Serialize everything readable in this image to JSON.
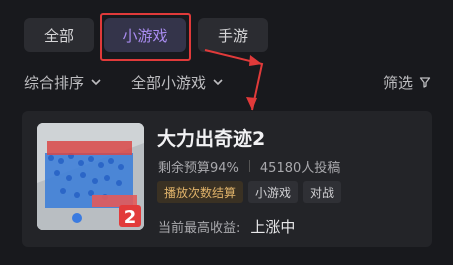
{
  "tabs": [
    {
      "label": "全部"
    },
    {
      "label": "小游戏"
    },
    {
      "label": "手游"
    }
  ],
  "filters": {
    "sort_label": "综合排序",
    "category_label": "全部小游戏",
    "screen_label": "筛选"
  },
  "card": {
    "title": "大力出奇迹2",
    "budget": "剩余预算94%",
    "submissions": "45180人投稿",
    "tags": [
      "播放次数结算",
      "小游戏",
      "对战"
    ],
    "earning_label": "当前最高收益:",
    "earning_value": "上涨中"
  },
  "colors": {
    "accent_purple": "#a98cf0",
    "highlight_red": "#e03a3a",
    "tag_gold": "#e0b36a"
  }
}
